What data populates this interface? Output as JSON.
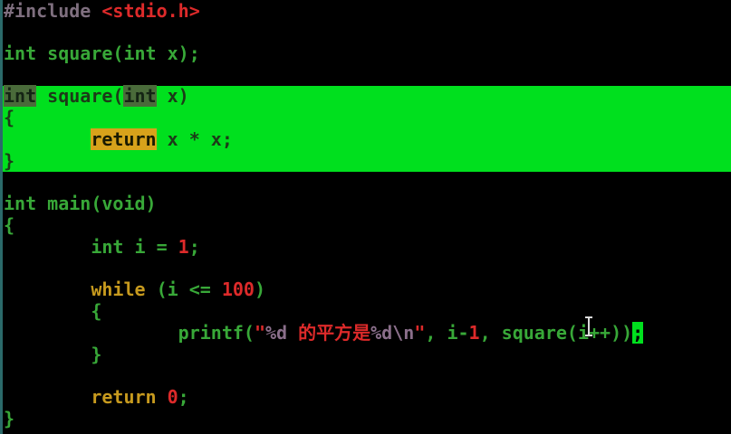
{
  "editor": {
    "lines": [
      {
        "a": "#include ",
        "b": "<stdio.h>"
      },
      {
        "text": "int square(int x);"
      },
      {
        "t1": "int",
        "t2": " square(",
        "t3": "int",
        "t4": " x)"
      },
      {
        "text": "{"
      },
      {
        "indent": "        ",
        "kw": "return",
        "rest": " x * x;"
      },
      {
        "text": "}"
      },
      {
        "kw": "int",
        "rest": " main(void)"
      },
      {
        "text": "{"
      },
      {
        "indent": "        ",
        "kw": "int",
        "mid": " i = ",
        "num": "1",
        "end": ";"
      },
      {
        "indent": "        ",
        "kw": "while",
        "mid": " (i <= ",
        "num": "100",
        "end": ")"
      },
      {
        "indent": "        ",
        "text": "{"
      },
      {
        "indent": "                ",
        "fn": "printf(",
        "q1": "\"",
        "f1": "%d",
        "cn": " 的平方是",
        "f2": "%d\\n",
        "q2": "\"",
        "a1": ", i-",
        "n1": "1",
        "a2": ", square(i++))",
        "semi": ";"
      },
      {
        "indent": "        ",
        "text": "}"
      },
      {
        "indent": "        ",
        "kw": "return",
        "mid": " ",
        "num": "0",
        "end": ";"
      },
      {
        "text": "}"
      }
    ]
  },
  "colors": {
    "background": "#000000",
    "selection": "#00e01e",
    "type": "#38a838",
    "string": "#dd2a2a",
    "keyword": "#c79a1e",
    "preprocessor": "#7f6f7f"
  }
}
